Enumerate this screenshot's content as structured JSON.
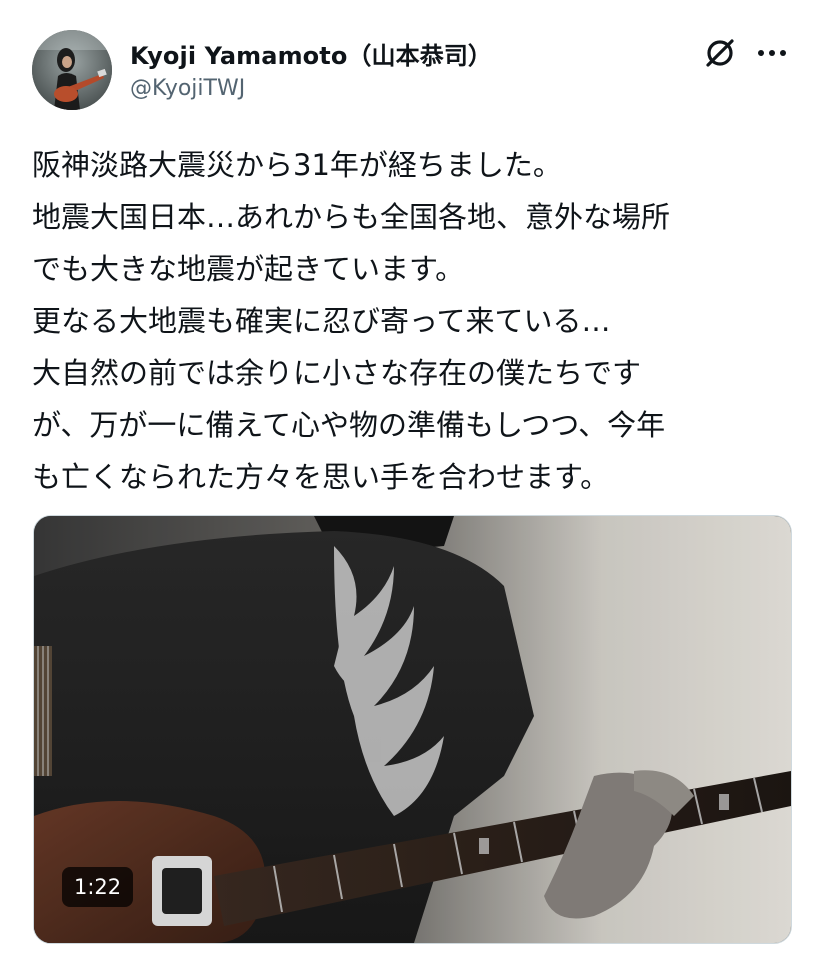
{
  "author": {
    "display_name": "Kyoji Yamamoto（山本恭司）",
    "handle": "@KyojiTWJ",
    "avatar_icon": "avatar-guitarist"
  },
  "header_actions": {
    "grok_icon": "grok-icon",
    "more_icon": "more-icon"
  },
  "tweet": {
    "lines": [
      "阪神淡路大震災から31年が経ちました。",
      "地震大国日本…あれからも全国各地、意外な場所",
      "でも大きな地震が起きています。",
      "更なる大地震も確実に忍び寄って来ている…",
      "大自然の前では余りに小さな存在の僕たちです",
      "が、万が一に備えて心や物の準備もしつつ、今年",
      "も亡くなられた方々を思い手を合わせます。"
    ]
  },
  "media": {
    "type": "video",
    "duration": "1:22",
    "description_icon": "video-thumbnail"
  }
}
